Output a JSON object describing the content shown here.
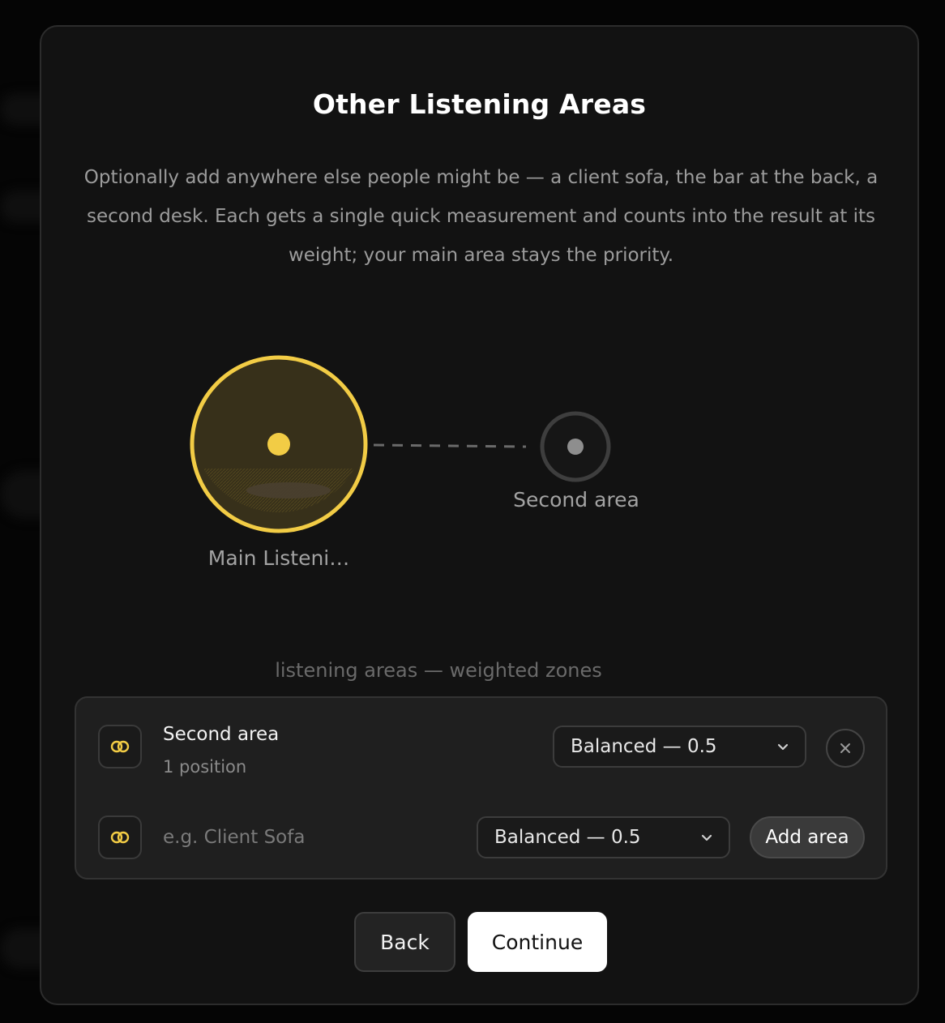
{
  "dialog": {
    "title": "Other Listening Areas",
    "description": "Optionally add anywhere else people might be — a client sofa, the bar at the back, a second desk. Each gets a single quick measurement and counts into the result at its weight; your main area stays the priority."
  },
  "visualization": {
    "main_area_label": "Main Listeni…",
    "second_area_label": "Second area",
    "caption": "listening areas — weighted zones",
    "accent_color": "#f2cc45"
  },
  "areas": {
    "existing": {
      "icon": "ear-icon",
      "name": "Second area",
      "positions": "1 position",
      "weight_selected": "Balanced — 0.5",
      "remove_icon": "close-icon"
    },
    "new_area": {
      "icon": "ear-icon",
      "name_value": "",
      "name_placeholder": "e.g. Client Sofa",
      "weight_selected": "Balanced — 0.5",
      "add_label": "Add area"
    }
  },
  "footer": {
    "back_label": "Back",
    "continue_label": "Continue"
  }
}
